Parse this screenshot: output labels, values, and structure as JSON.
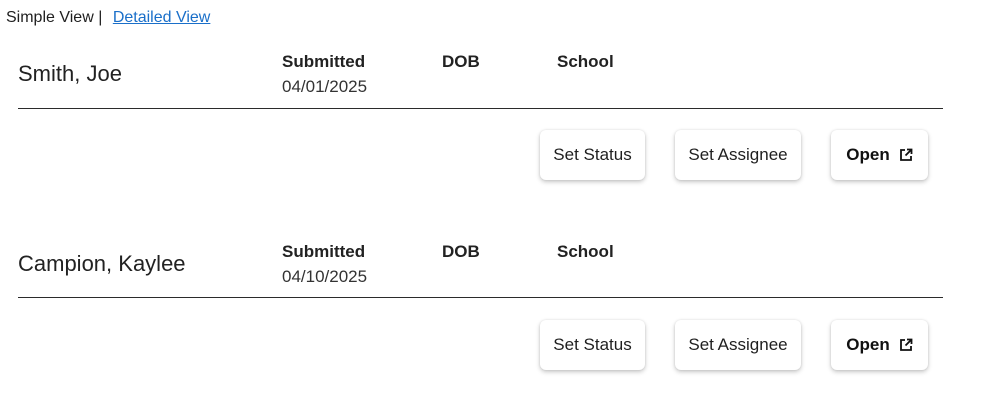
{
  "view_toggle": {
    "simple_label": "Simple View",
    "separator": "|",
    "detailed_label": "Detailed View"
  },
  "field_labels": {
    "submitted": "Submitted",
    "dob": "DOB",
    "school": "School"
  },
  "actions": {
    "set_status": "Set Status",
    "set_assignee": "Set Assignee",
    "open": "Open",
    "open_icon": "external-link-icon"
  },
  "records": [
    {
      "name": "Smith, Joe",
      "submitted": "04/01/2025",
      "dob": "",
      "school": ""
    },
    {
      "name": "Campion, Kaylee",
      "submitted": "04/10/2025",
      "dob": "",
      "school": ""
    }
  ],
  "colors": {
    "link": "#1a6fc9",
    "divider": "#2b2b2b",
    "text": "#1f1f1f"
  }
}
